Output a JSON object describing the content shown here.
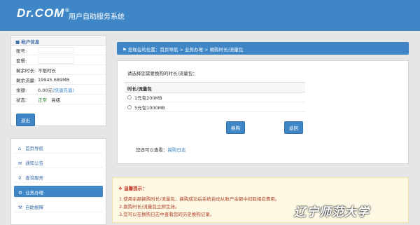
{
  "header": {
    "logo": "Dr.COM",
    "logo_mark": "®",
    "title": "用户自助服务系统"
  },
  "account": {
    "title": "帐户信息",
    "rows": [
      {
        "key": "账号:",
        "value": ""
      },
      {
        "key": "套餐:",
        "value": ""
      },
      {
        "key": "剩余时长:",
        "value": "不限时长"
      },
      {
        "key": "剩余流量:",
        "value": "19945.689MB"
      },
      {
        "key": "余额:",
        "value": "0.00元",
        "extra": "(快速充值)"
      },
      {
        "key": "状态:",
        "value": "正常",
        "extra": "高级"
      }
    ],
    "exit_label": "退出"
  },
  "nav": {
    "items": [
      {
        "label": "首页导航"
      },
      {
        "label": "通知公告"
      },
      {
        "label": "查询服务"
      },
      {
        "label": "业务办理"
      },
      {
        "label": "自助报障"
      }
    ]
  },
  "breadcrumb": "您现在的位置：首页导航 > 业务办理 > 换购时长/流量包",
  "main": {
    "prompt": "请选择您需要换购的时长/流量包：",
    "table_header": "时长/流量包",
    "options": [
      "1元包200MB",
      "5元包1000MB"
    ],
    "buy_label": "换购",
    "back_label": "返回",
    "see_prefix": "您还可以查看：",
    "see_link": "换购日志"
  },
  "tips": {
    "title": "温馨提示：",
    "lines": [
      "1.使用余额换购时长/流量包，换购成功后系统自动从账户余额中扣取相应费用。",
      "2.换购时长/流量包立即生效。",
      "3.您可以在换购日志中查看您的历史换购记录。"
    ]
  },
  "watermark": "辽宁师范大学"
}
